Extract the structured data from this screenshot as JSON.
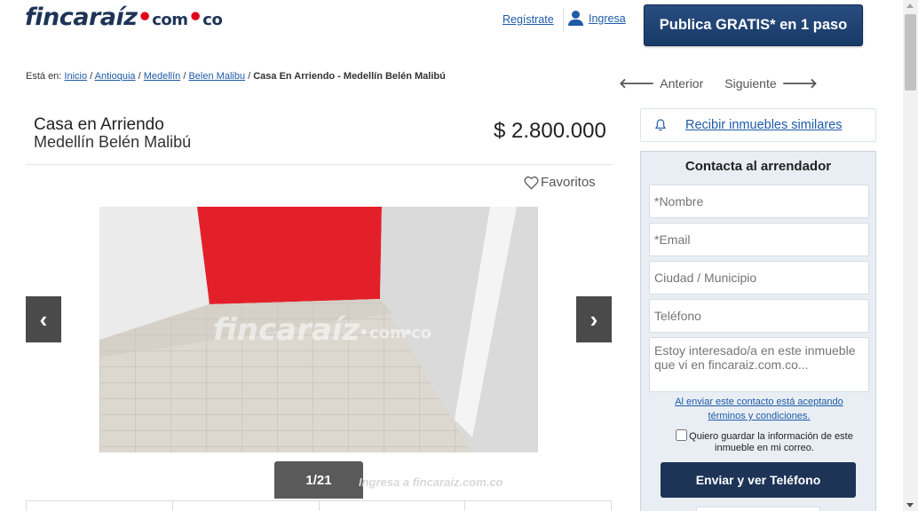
{
  "header": {
    "logo_main": "fincaraíz",
    "logo_com": "com",
    "logo_co": "co",
    "register_label": "Regístrate",
    "login_label": "Ingresa",
    "publish_button": "Publica GRATIS* en 1 paso"
  },
  "breadcrumb": {
    "prefix": "Está en:",
    "items": [
      "Inicio",
      "Antioquia",
      "Medellín",
      "Belen Malibu"
    ],
    "current": "Casa En Arriendo - Medellín Belén Malibú"
  },
  "navigation": {
    "previous": "Anterior",
    "next": "Siguiente"
  },
  "listing": {
    "type": "Casa en Arriendo",
    "location": "Medellín Belén Malibú",
    "price": "$ 2.800.000",
    "favorites_label": "Favoritos"
  },
  "gallery": {
    "watermark": "fincaraíz",
    "watermark_com": "com",
    "watermark_co": "co",
    "counter": "1/21",
    "thumb_watermark": "Ingresa a fincaraiz.com.co"
  },
  "similar": {
    "label": "Recibir inmuebles similares"
  },
  "contact": {
    "title": "Contacta al arrendador",
    "name_placeholder": "*Nombre",
    "email_placeholder": "*Email",
    "city_placeholder": "Ciudad / Municipio",
    "phone_placeholder": "Teléfono",
    "message_placeholder": "Estoy interesado/a en este inmueble que vi en fincaraiz.com.co...",
    "terms": "Al enviar este contacto está aceptando términos y condiciones.",
    "save_info": "Quiero guardar la información de este inmueble en mi correo.",
    "send_button": "Enviar y ver Teléfono"
  },
  "colors": {
    "brand_navy": "#1d3457",
    "brand_red": "#e2001a",
    "link_blue": "#1e5ba8"
  }
}
